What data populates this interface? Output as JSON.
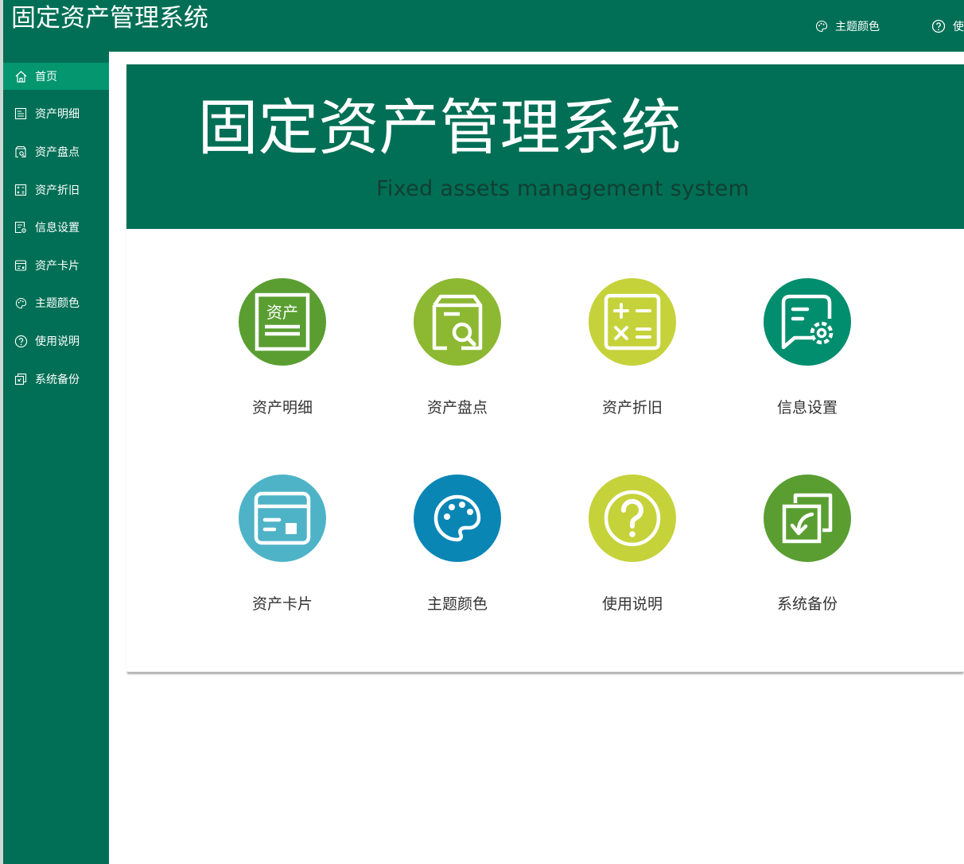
{
  "app": {
    "title": "固定资产管理系统"
  },
  "header": {
    "theme_label": "主题颜色",
    "help_label": "使"
  },
  "sidebar": {
    "items": [
      {
        "label": "首页",
        "icon": "home-icon",
        "active": true
      },
      {
        "label": "资产明细",
        "icon": "list-doc-icon"
      },
      {
        "label": "资产盘点",
        "icon": "box-search-icon"
      },
      {
        "label": "资产折旧",
        "icon": "calculator-icon"
      },
      {
        "label": "信息设置",
        "icon": "doc-settings-icon"
      },
      {
        "label": "资产卡片",
        "icon": "card-icon"
      },
      {
        "label": "主题颜色",
        "icon": "palette-icon"
      },
      {
        "label": "使用说明",
        "icon": "question-circle-icon"
      },
      {
        "label": "系统备份",
        "icon": "backup-icon"
      }
    ]
  },
  "banner": {
    "title": "固定资产管理系统",
    "subtitle": "Fixed assets management system"
  },
  "tiles": [
    {
      "label": "资产明细",
      "icon": "asset-doc-icon",
      "badge_text": "资产",
      "color": "#5a9e32"
    },
    {
      "label": "资产盘点",
      "icon": "box-search-icon",
      "color": "#8db832"
    },
    {
      "label": "资产折旧",
      "icon": "calculator-icon",
      "color": "#c5d23a"
    },
    {
      "label": "信息设置",
      "icon": "chat-settings-icon",
      "color": "#008e6e"
    },
    {
      "label": "资产卡片",
      "icon": "card-icon",
      "color": "#4fb3c8"
    },
    {
      "label": "主题颜色",
      "icon": "palette-icon",
      "color": "#0a86b5"
    },
    {
      "label": "使用说明",
      "icon": "question-circle-icon",
      "color": "#c5d23a"
    },
    {
      "label": "系统备份",
      "icon": "backup-icon",
      "color": "#5a9e32"
    }
  ],
  "colors": {
    "primary": "#006f55",
    "active_nav": "#03966f",
    "subtitle": "#123e33"
  }
}
